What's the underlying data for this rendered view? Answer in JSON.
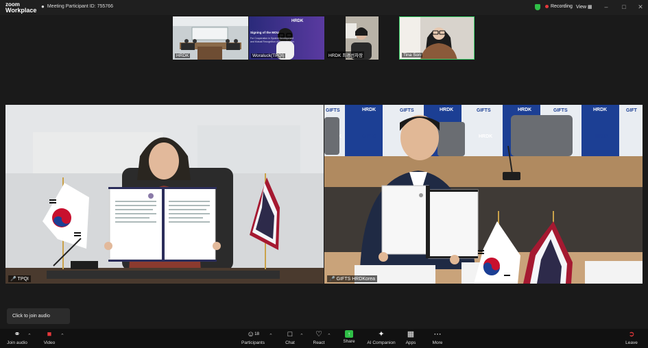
{
  "app": {
    "logo_line1": "zoom",
    "logo_line2": "Workplace"
  },
  "meeting": {
    "id_label": "Meeting Participant ID: 755766"
  },
  "status": {
    "recording": "Recording",
    "view": "View"
  },
  "thumbnails": [
    {
      "name": "HRDK"
    },
    {
      "name": "Woraluck(TPQI)",
      "slide_title": "Signing of the MOU",
      "slide_sub1": "For Cooperation in System Development",
      "slide_sub2": "and Mutual Recognition of Competencies",
      "logo": "HRDK"
    },
    {
      "name": "HRDK 최경선차장"
    },
    {
      "name": "Tina Son"
    }
  ],
  "main_tiles": [
    {
      "name": "TPQI"
    },
    {
      "name": "GIFTS HRDKorea",
      "banner_a": "GIFTS",
      "banner_b": "HRDK"
    }
  ],
  "toast": {
    "text": "Click to join audio"
  },
  "toolbar": {
    "join_audio": "Join audio",
    "video": "Video",
    "participants": "Participants",
    "participants_count": "18",
    "chat": "Chat",
    "react": "React",
    "share": "Share",
    "ai_companion": "AI Companion",
    "apps": "Apps",
    "more": "More",
    "leave": "Leave"
  },
  "colors": {
    "accent_green": "#2fbf47",
    "record_red": "#e5383b",
    "banner_blue": "#1c3f94"
  },
  "icons": [
    "zoom-logo",
    "shield-icon",
    "grid-icon",
    "headphone-icon",
    "video-off-icon",
    "people-icon",
    "chat-icon",
    "heart-icon",
    "share-icon",
    "sparkle-icon",
    "apps-icon",
    "more-icon",
    "leave-icon"
  ]
}
